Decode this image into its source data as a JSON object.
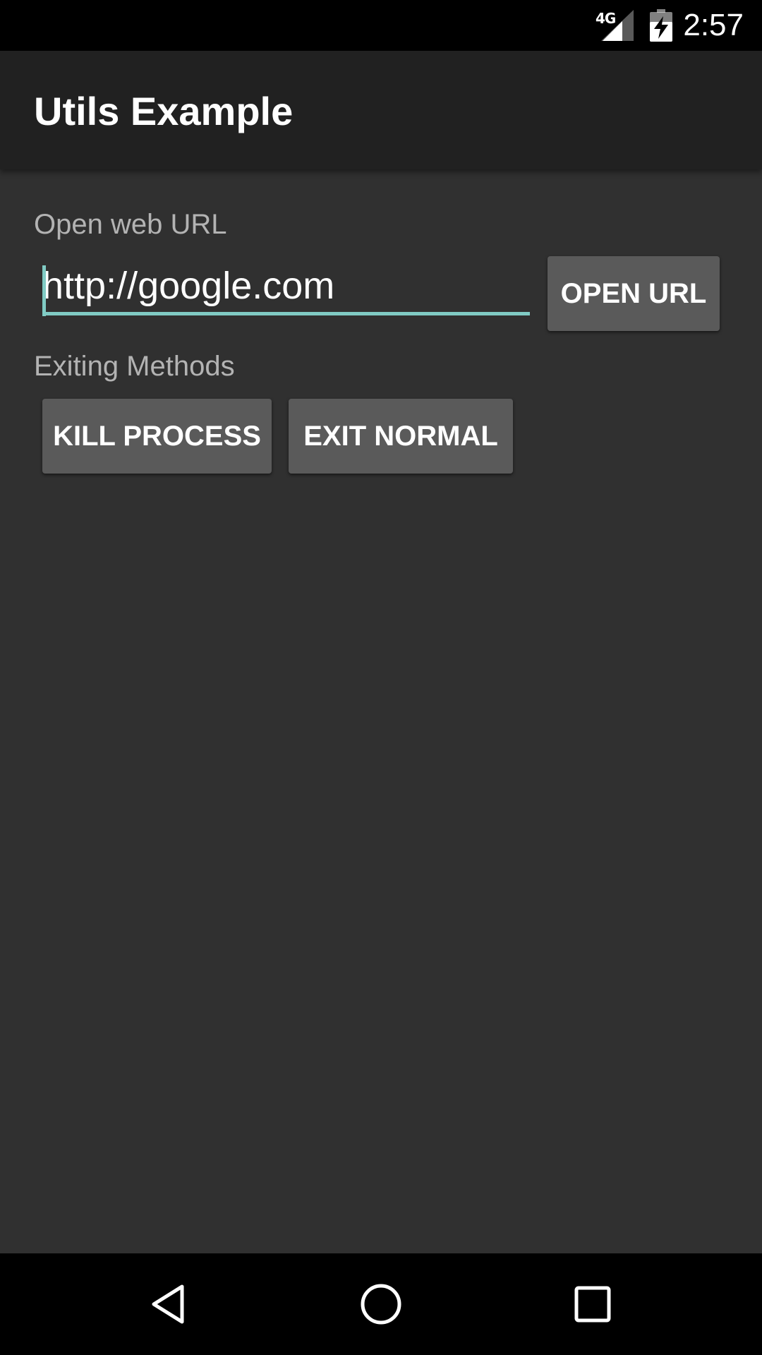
{
  "status_bar": {
    "network": "4G",
    "time": "2:57",
    "icons": [
      "signal-icon",
      "battery-charging-icon"
    ]
  },
  "app_bar": {
    "title": "Utils Example"
  },
  "content": {
    "open_url_label": "Open web URL",
    "url_value": "http://google.com",
    "open_url_button": "OPEN URL",
    "exiting_label": "Exiting Methods",
    "kill_process_button": "KILL PROCESS",
    "exit_normal_button": "EXIT NORMAL"
  },
  "nav_bar": {
    "icons": [
      "back-icon",
      "home-icon",
      "recents-icon"
    ]
  },
  "colors": {
    "background": "#303030",
    "app_bar": "#212121",
    "accent": "#80cbc4",
    "button": "#5a5a5a",
    "label": "#b3b3b3"
  }
}
